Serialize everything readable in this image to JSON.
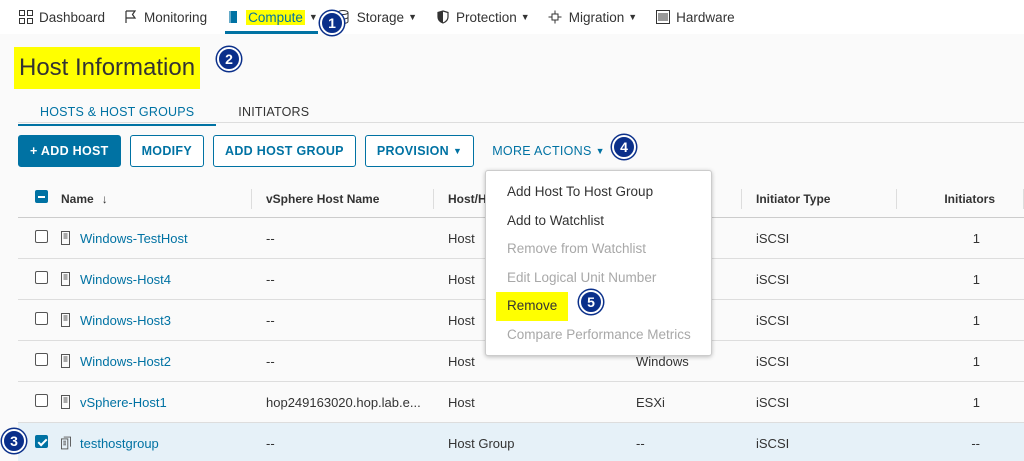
{
  "nav": {
    "items": [
      {
        "label": "Dashboard",
        "icon": "dashboard-icon",
        "caret": false,
        "active": false
      },
      {
        "label": "Monitoring",
        "icon": "flag-icon",
        "caret": false,
        "active": false
      },
      {
        "label": "Compute",
        "icon": "compute-icon",
        "caret": true,
        "active": true
      },
      {
        "label": "Storage",
        "icon": "database-icon",
        "caret": true,
        "active": false
      },
      {
        "label": "Protection",
        "icon": "shield-icon",
        "caret": true,
        "active": false
      },
      {
        "label": "Migration",
        "icon": "migration-icon",
        "caret": true,
        "active": false
      },
      {
        "label": "Hardware",
        "icon": "hardware-icon",
        "caret": false,
        "active": false
      }
    ]
  },
  "page": {
    "title": "Host Information"
  },
  "tabs": [
    {
      "label": "HOSTS & HOST GROUPS",
      "active": true
    },
    {
      "label": "INITIATORS",
      "active": false
    }
  ],
  "toolbar": {
    "add_host": "+ ADD HOST",
    "modify": "MODIFY",
    "add_host_group": "ADD HOST GROUP",
    "provision": "PROVISION",
    "more_actions": "MORE ACTIONS"
  },
  "table": {
    "columns": {
      "name": "Name",
      "vsphere": "vSphere Host Name",
      "type": "Host/H",
      "initiator_type": "Initiator Type",
      "initiators": "Initiators"
    },
    "rows": [
      {
        "name": "Windows-TestHost",
        "vsphere": "--",
        "type": "Host",
        "os": "",
        "initiator_type": "iSCSI",
        "initiators": "1",
        "checked": false
      },
      {
        "name": "Windows-Host4",
        "vsphere": "--",
        "type": "Host",
        "os": "",
        "initiator_type": "iSCSI",
        "initiators": "1",
        "checked": false
      },
      {
        "name": "Windows-Host3",
        "vsphere": "--",
        "type": "Host",
        "os": "",
        "initiator_type": "iSCSI",
        "initiators": "1",
        "checked": false
      },
      {
        "name": "Windows-Host2",
        "vsphere": "--",
        "type": "Host",
        "os": "Windows",
        "initiator_type": "iSCSI",
        "initiators": "1",
        "checked": false
      },
      {
        "name": "vSphere-Host1",
        "vsphere": "hop249163020.hop.lab.e...",
        "type": "Host",
        "os": "ESXi",
        "initiator_type": "iSCSI",
        "initiators": "1",
        "checked": false
      },
      {
        "name": "testhostgroup",
        "vsphere": "--",
        "type": "Host Group",
        "os": "--",
        "initiator_type": "iSCSI",
        "initiators": "--",
        "checked": true
      }
    ]
  },
  "menu": {
    "items": [
      {
        "label": "Add Host To Host Group",
        "disabled": false
      },
      {
        "label": "Add to Watchlist",
        "disabled": false
      },
      {
        "label": "Remove from Watchlist",
        "disabled": true
      },
      {
        "label": "Edit Logical Unit Number",
        "disabled": true
      },
      {
        "label": "Remove",
        "disabled": false,
        "highlighted": true
      },
      {
        "label": "Compare Performance Metrics",
        "disabled": true
      }
    ]
  },
  "callouts": [
    "1",
    "2",
    "3",
    "4",
    "5"
  ],
  "colors": {
    "accent": "#0072a3",
    "highlight": "#ffff00",
    "callout": "#0a2f8a"
  }
}
